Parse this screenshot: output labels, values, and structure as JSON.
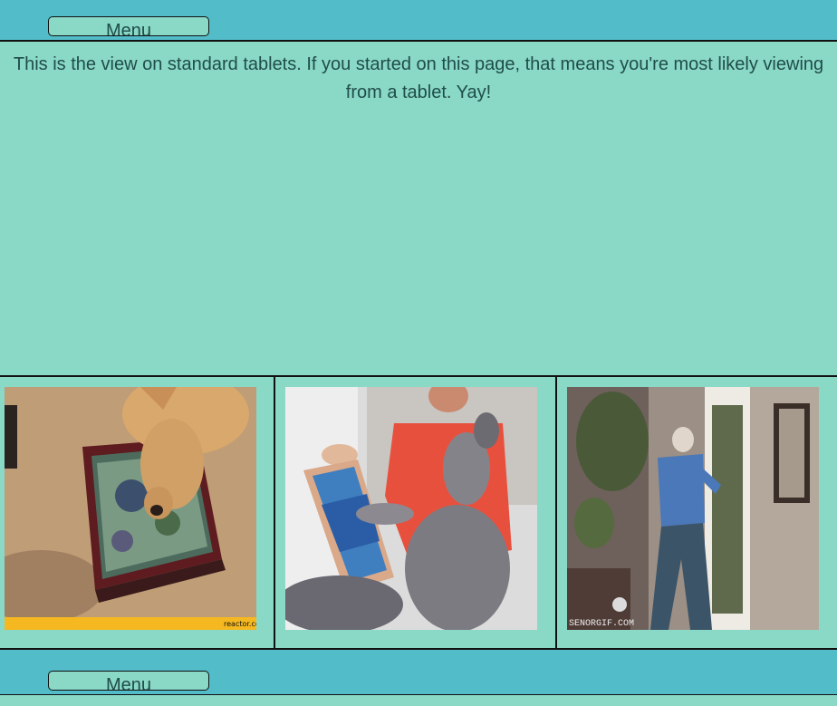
{
  "header": {
    "menu_label": "Menu"
  },
  "intro_text": "This is the view on standard tablets. If you started on this page, that means you're most likely viewing from a tablet. Yay!",
  "gallery": [
    {
      "name": "dog-tablet-gif",
      "watermark": "reactor.cc"
    },
    {
      "name": "cat-tablet-gif",
      "watermark": ""
    },
    {
      "name": "dancing-man-gif",
      "watermark": "SENORGIF.COM"
    }
  ],
  "footer": {
    "menu_label": "Menu"
  },
  "colors": {
    "bar": "#52bcc8",
    "background": "#8ad8c6",
    "text": "#1f4d4a",
    "border": "#111111"
  }
}
